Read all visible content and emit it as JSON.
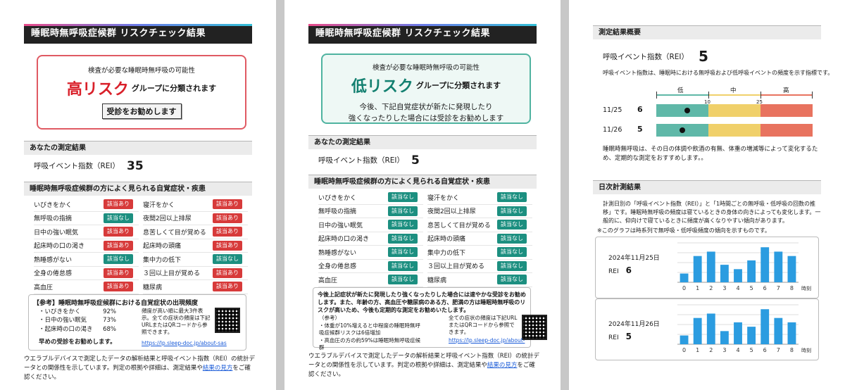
{
  "common": {
    "header_title": "睡眠時無呼吸症候群 リスクチェック結果",
    "measure_section": "あなたの測定結果",
    "rei_label": "呼吸イベント指数（REI）",
    "symptom_section": "睡眠時無呼吸症候群の方によく見られる自覚症状・疾患",
    "badge_yes": "該当あり",
    "badge_no": "該当なし"
  },
  "page1": {
    "risk_sub": "検査が必要な睡眠時無呼吸の可能性",
    "risk_level": "高リスク",
    "risk_group": "グループに分類されます",
    "cta": "受診をお勧めします",
    "rei_value": "35",
    "symptoms": [
      [
        {
          "label": "いびきをかく",
          "yes": true
        },
        {
          "label": "寝汗をかく",
          "yes": true
        }
      ],
      [
        {
          "label": "無呼吸の指摘",
          "yes": false
        },
        {
          "label": "夜間2回以上排尿",
          "yes": true
        }
      ],
      [
        {
          "label": "日中の強い眠気",
          "yes": true
        },
        {
          "label": "息苦しくて目が覚める",
          "yes": true
        }
      ],
      [
        {
          "label": "起床時の口の渇き",
          "yes": true
        },
        {
          "label": "起床時の頭痛",
          "yes": true
        }
      ],
      [
        {
          "label": "熟睡感がない",
          "yes": false
        },
        {
          "label": "集中力の低下",
          "yes": false
        }
      ],
      [
        {
          "label": "全身の倦怠感",
          "yes": true
        },
        {
          "label": "３回以上目が覚める",
          "yes": true
        }
      ],
      [
        {
          "label": "高血圧",
          "yes": true
        },
        {
          "label": "糖尿病",
          "yes": true
        }
      ]
    ],
    "ref_title": "【参考】睡眠時無呼吸症候群における自覚症状の出現頻度",
    "ref_items": [
      {
        "label": "・いびきをかく",
        "value": "92%"
      },
      {
        "label": "・日中の強い眠気",
        "value": "73%"
      },
      {
        "label": "・起床時の口の渇き",
        "value": "68%"
      }
    ],
    "ref_note": "頻度が高い順に最大3件表示。全ての症状の頻度は下記URLまたはQRコードから参照できます。",
    "ref_cta": "早めの受診をお勧めします。",
    "ref_url": "https://lp.sleep-doc.jp/about-sas",
    "foot_pre": "ウエラブルデバイスで測定したデータの解析結果と呼吸イベント指数（REI）の統計データとの関係性を示しています。判定の根拠や詳細は、測定結果や",
    "foot_link": "結果の見方",
    "foot_post": "をご確認ください。"
  },
  "page2": {
    "risk_sub": "検査が必要な睡眠時無呼吸の可能性",
    "risk_level": "低リスク",
    "risk_group": "グループに分類されます",
    "advice_1": "今後、下記自覚症状が新たに発現したり",
    "advice_2": "強くなったりした場合には受診をお勧めします",
    "rei_value": "5",
    "symptoms": [
      [
        {
          "label": "いびきをかく",
          "yes": false
        },
        {
          "label": "寝汗をかく",
          "yes": false
        }
      ],
      [
        {
          "label": "無呼吸の指摘",
          "yes": false
        },
        {
          "label": "夜間2回以上排尿",
          "yes": false
        }
      ],
      [
        {
          "label": "日中の強い眠気",
          "yes": false
        },
        {
          "label": "息苦しくて目が覚める",
          "yes": false
        }
      ],
      [
        {
          "label": "起床時の口の渇き",
          "yes": false
        },
        {
          "label": "起床時の頭痛",
          "yes": false
        }
      ],
      [
        {
          "label": "熟睡感がない",
          "yes": false
        },
        {
          "label": "集中力の低下",
          "yes": false
        }
      ],
      [
        {
          "label": "全身の倦怠感",
          "yes": false
        },
        {
          "label": "３回以上目が覚める",
          "yes": false
        }
      ],
      [
        {
          "label": "高血圧",
          "yes": false
        },
        {
          "label": "糖尿病",
          "yes": false
        }
      ]
    ],
    "note_main": "今後上記症状が新たに発現したり強くなったりした場合には速やかな受診をお勧めします。また、年齢の方、高血圧や糖尿病のある方、肥満の方は睡眠時無呼吸のリスクが高いため、今後も定期的な測定をお勧めいたします。",
    "ref_head": "（参考）",
    "ref_l1": "・体重が10%増えると中程度の睡眠時無呼吸症候群リスクは6倍増加",
    "ref_l2": "・高血圧の方の約59%は睡眠時無呼吸症候群",
    "ref_note": "全ての症状の頻度は下記URLまたはQRコードから参照できます。",
    "ref_url": "https://lp.sleep-doc.jp/about-",
    "foot_pre": "ウエラブルデバイスで測定したデータの解析結果と呼吸イベント指数（REI）の統計データとの関係性を示しています。判定の根拠や詳細は、測定結果や",
    "foot_link": "結果の見方",
    "foot_post": "をご確認ください。"
  },
  "page3": {
    "summary_section": "測定結果概要",
    "rei_label": "呼吸イベント指数（REI）",
    "rei_value": "5",
    "rei_desc": "呼吸イベント指数は、睡眠時における無呼吸および低呼吸イベントの頻度を示す指標です。",
    "scale_low": "低",
    "scale_mid": "中",
    "scale_high": "高",
    "tick_10": "10",
    "tick_25": "25",
    "rows": [
      {
        "date": "11/25",
        "value": "6",
        "rei": 6
      },
      {
        "date": "11/26",
        "value": "5",
        "rei": 5
      }
    ],
    "scale_note": "睡眠時無呼吸は、その日の体調や飲酒の有無、体重の増減等によって変化するため、定期的な測定をおすすめします。。",
    "daily_section": "日次計測結果",
    "daily_desc": "計測日別の「呼吸イベント指数（REI）」と「1時間ごとの無呼吸・低呼吸の回数の推移」です。睡眠時無呼吸の頻度は寝ているときの身体の向きによっても変化します。一般的に、仰向けで寝ているときに頻度が高くなりやすい傾向があります。",
    "daily_note": "※このグラフは時系列で無呼吸・低呼吸頻度の傾向を示すものです。",
    "hour_unit": "時刻",
    "colors": {
      "low": "#5fb8a8",
      "mid": "#f0d06a",
      "high": "#e8735f",
      "bar": "#2b9ce0"
    }
  },
  "chart_data": [
    {
      "type": "bar",
      "title": "2024年11月25日",
      "subtitle": "REI 6",
      "categories": [
        "0",
        "1",
        "2",
        "3",
        "4",
        "5",
        "6",
        "7",
        "8"
      ],
      "values": [
        2,
        6,
        7,
        4,
        3,
        5,
        8,
        7,
        6
      ],
      "xlabel": "時刻",
      "ylim": [
        0,
        9
      ]
    },
    {
      "type": "bar",
      "title": "2024年11月26日",
      "subtitle": "REI 5",
      "categories": [
        "0",
        "1",
        "2",
        "3",
        "4",
        "5",
        "6",
        "7",
        "8"
      ],
      "values": [
        2,
        6,
        7,
        3,
        5,
        4,
        8,
        6,
        5
      ],
      "xlabel": "時刻",
      "ylim": [
        0,
        9
      ]
    }
  ]
}
